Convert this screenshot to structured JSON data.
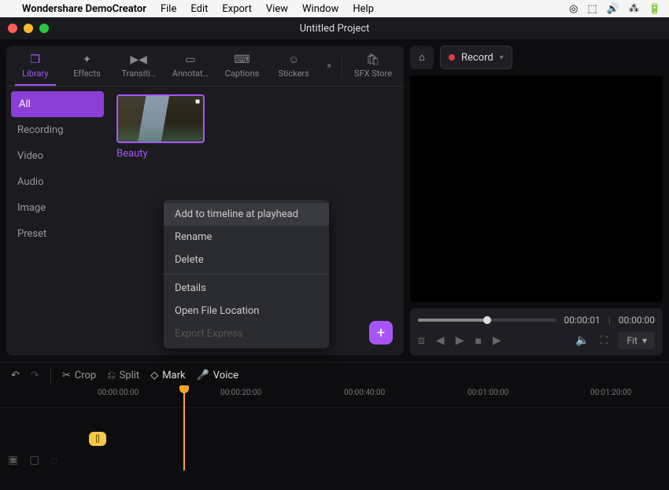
{
  "menubar": {
    "apple": "",
    "appname": "Wondershare DemoCreator",
    "items": [
      "File",
      "Edit",
      "Export",
      "View",
      "Window",
      "Help"
    ]
  },
  "window": {
    "title": "Untitled Project"
  },
  "tabs": {
    "items": [
      {
        "label": "Library",
        "icon": "❒"
      },
      {
        "label": "Effects",
        "icon": "✦"
      },
      {
        "label": "Transiti…",
        "icon": "▶◀"
      },
      {
        "label": "Annotat…",
        "icon": "▭"
      },
      {
        "label": "Captions",
        "icon": "⌨"
      },
      {
        "label": "Stickers",
        "icon": "☺"
      }
    ],
    "more": "»",
    "sfx": {
      "label": "SFX Store",
      "icon": "🛍"
    }
  },
  "sidebar": {
    "items": [
      "All",
      "Recording",
      "Video",
      "Audio",
      "Image",
      "Preset"
    ]
  },
  "media": {
    "thumb_label": "Beauty"
  },
  "context_menu": {
    "items": [
      {
        "label": "Add to timeline at playhead",
        "state": "hover"
      },
      {
        "label": "Rename",
        "state": ""
      },
      {
        "label": "Delete",
        "state": ""
      },
      {
        "label": "---sep---",
        "state": ""
      },
      {
        "label": "Details",
        "state": ""
      },
      {
        "label": "Open File Location",
        "state": ""
      },
      {
        "label": "Export Express",
        "state": "disabled"
      }
    ]
  },
  "preview": {
    "record": "Record",
    "time_current": "00:00:01",
    "time_total": "00:00:00",
    "fit": "Fit"
  },
  "timeline": {
    "tools": {
      "crop": "Crop",
      "split": "Split",
      "mark": "Mark",
      "voice": "Voice"
    },
    "ticks": [
      "00:00:00:00",
      "00:00:20:00",
      "00:00:40:00",
      "00:01:00:00",
      "00:01:20:00"
    ],
    "marker": "[]"
  },
  "add_button": "+"
}
